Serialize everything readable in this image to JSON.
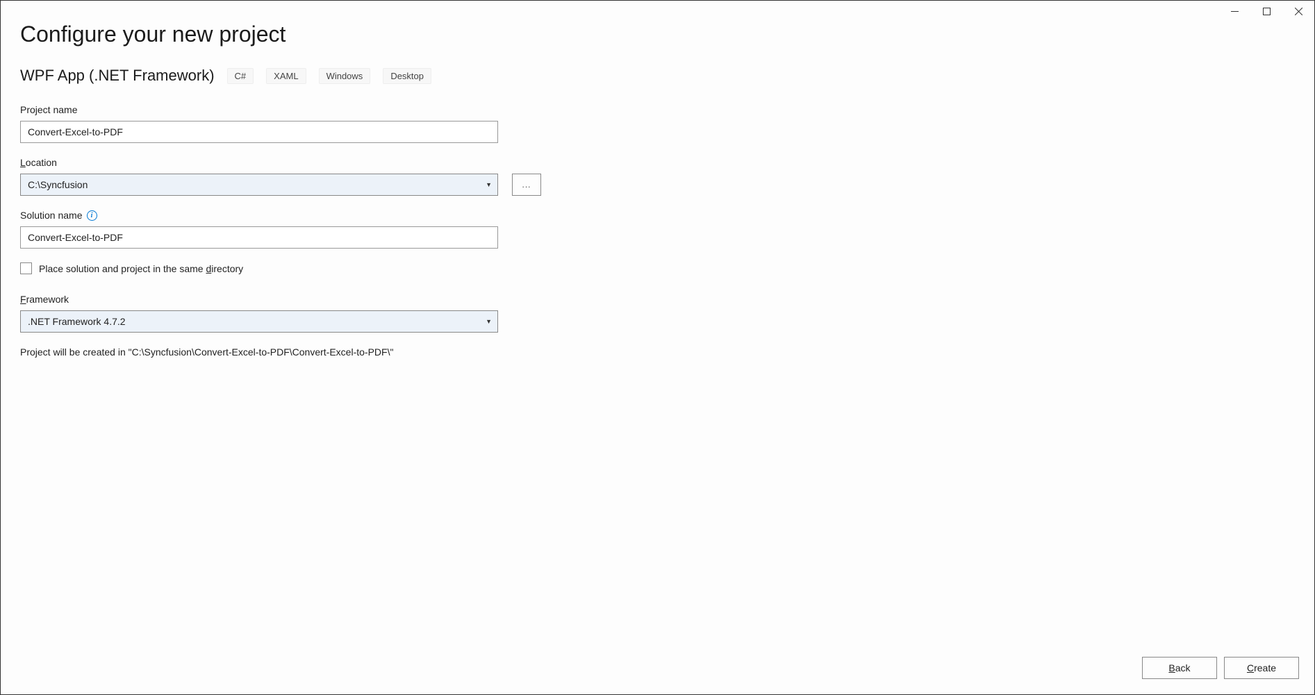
{
  "titlebar": {
    "minimize_tip": "Minimize",
    "maximize_tip": "Maximize",
    "close_tip": "Close"
  },
  "header": {
    "title": "Configure your new project",
    "subtitle": "WPF App (.NET Framework)",
    "tags": [
      "C#",
      "XAML",
      "Windows",
      "Desktop"
    ]
  },
  "form": {
    "project_name_label": "Project name",
    "project_name_value": "Convert-Excel-to-PDF",
    "location_label_pre": "L",
    "location_label_rest": "ocation",
    "location_value": "C:\\Syncfusion",
    "browse_text": "...",
    "solution_name_label": "Solution name",
    "solution_name_value": "Convert-Excel-to-PDF",
    "same_dir_pre": "Place solution and project in the same ",
    "same_dir_u": "d",
    "same_dir_post": "irectory",
    "framework_label_pre": "F",
    "framework_label_rest": "ramework",
    "framework_value": ".NET Framework 4.7.2",
    "creation_info": "Project will be created in \"C:\\Syncfusion\\Convert-Excel-to-PDF\\Convert-Excel-to-PDF\\\""
  },
  "footer": {
    "back_pre": "B",
    "back_rest": "ack",
    "create_pre": "C",
    "create_rest": "reate"
  }
}
